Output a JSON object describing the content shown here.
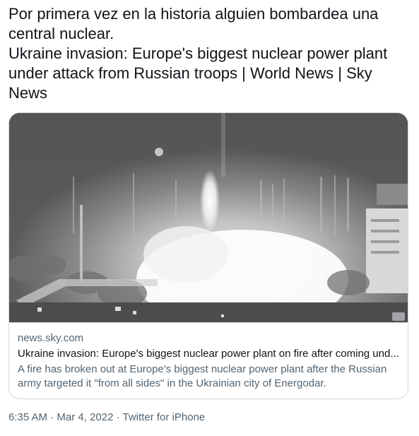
{
  "tweet": {
    "text": "Por primera vez en la historia alguien bombardea una central nuclear.\nUkraine invasion: Europe's biggest nuclear power plant under attack from Russian troops | World News | Sky News"
  },
  "card": {
    "image_description_icon": "night-cctv-image",
    "domain": "news.sky.com",
    "title": "Ukraine invasion: Europe's biggest nuclear power plant on fire after coming und...",
    "description": "A fire has broken out at Europe's biggest nuclear power plant after the Russian army targeted it \"from all sides\" in the Ukrainian city of Energodar."
  },
  "meta": {
    "time": "6:35 AM",
    "separator": "·",
    "date": "Mar 4, 2022",
    "source": "Twitter for iPhone"
  },
  "colors": {
    "text_primary": "#0f1419",
    "text_secondary": "#536471",
    "border": "#cfd9de"
  }
}
